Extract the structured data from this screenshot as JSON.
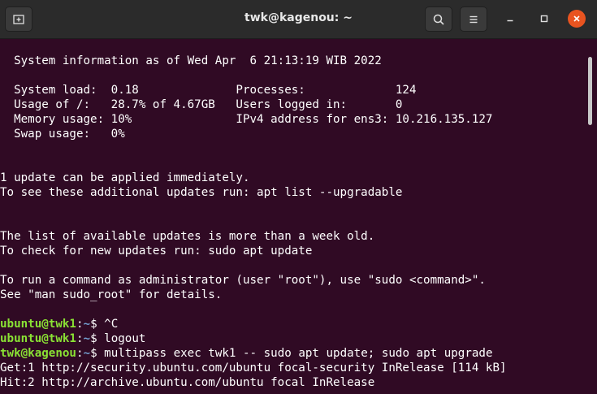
{
  "window": {
    "title": "twk@kagenou: ~",
    "icons": {
      "new_tab": "new-tab-icon",
      "search": "search-icon",
      "menu": "hamburger-menu-icon",
      "minimize": "minimize-icon",
      "maximize": "maximize-icon",
      "close": "close-icon"
    },
    "colors": {
      "background": "#300a24",
      "titlebar": "#2b2b2b",
      "close": "#e95420",
      "prompt_user": "#8ae234",
      "prompt_path": "#729fcf"
    }
  },
  "terminal": {
    "sysinfo": {
      "header": "  System information as of Wed Apr  6 21:13:19 WIB 2022",
      "row1": "  System load:  0.18              Processes:             124",
      "row2": "  Usage of /:   28.7% of 4.67GB   Users logged in:       0",
      "row3": "  Memory usage: 10%               IPv4 address for ens3: 10.216.135.127",
      "row4": "  Swap usage:   0%"
    },
    "updates": {
      "line1": "1 update can be applied immediately.",
      "line2": "To see these additional updates run: apt list --upgradable"
    },
    "stale": {
      "line1": "The list of available updates is more than a week old.",
      "line2": "To check for new updates run: sudo apt update"
    },
    "sudo_notice": {
      "line1": "To run a command as administrator (user \"root\"), use \"sudo <command>\".",
      "line2": "See \"man sudo_root\" for details."
    },
    "prompts": [
      {
        "user": "ubuntu@twk1",
        "sep": ":",
        "path": "~",
        "sym": "$ ",
        "cmd": "^C"
      },
      {
        "user": "ubuntu@twk1",
        "sep": ":",
        "path": "~",
        "sym": "$ ",
        "cmd": "logout"
      },
      {
        "user": "twk@kagenou",
        "sep": ":",
        "path": "~",
        "sym": "$ ",
        "cmd": "multipass exec twk1 -- sudo apt update; sudo apt upgrade"
      }
    ],
    "output": {
      "get1": "Get:1 http://security.ubuntu.com/ubuntu focal-security InRelease [114 kB]",
      "hit2": "Hit:2 http://archive.ubuntu.com/ubuntu focal InRelease"
    }
  }
}
